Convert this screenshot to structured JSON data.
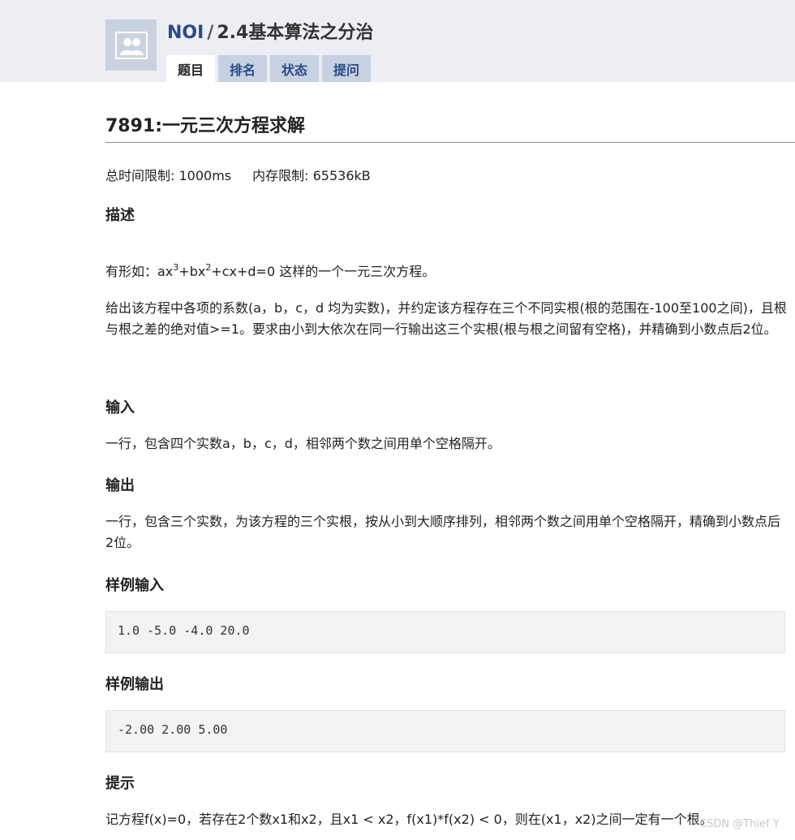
{
  "header": {
    "logo_icon": "people-avatar-icon",
    "site_name": "NOI",
    "separator": "/",
    "section": "2.4基本算法之分治",
    "tabs": [
      {
        "label": "题目",
        "active": true
      },
      {
        "label": "排名",
        "active": false
      },
      {
        "label": "状态",
        "active": false
      },
      {
        "label": "提问",
        "active": false
      }
    ]
  },
  "problem": {
    "title": "7891:一元三次方程求解",
    "time_limit": "总时间限制: 1000ms",
    "memory_limit": "内存限制: 65536kB",
    "sections": {
      "description": {
        "heading": "描述",
        "line1_prefix": "有形如：ax",
        "line1_sup1": "3",
        "line1_mid": "+bx",
        "line1_sup2": "2",
        "line1_suffix": "+cx+d=0  这样的一个一元三次方程。",
        "paragraph2": "给出该方程中各项的系数(a，b，c，d  均为实数)，并约定该方程存在三个不同实根(根的范围在-100至100之间)，且根与根之差的绝对值>=1。要求由小到大依次在同一行输出这三个实根(根与根之间留有空格)，并精确到小数点后2位。"
      },
      "input": {
        "heading": "输入",
        "text": "一行，包含四个实数a，b，c，d，相邻两个数之间用单个空格隔开。"
      },
      "output": {
        "heading": "输出",
        "text": "一行，包含三个实数，为该方程的三个实根，按从小到大顺序排列，相邻两个数之间用单个空格隔开，精确到小数点后2位。"
      },
      "sample_input": {
        "heading": "样例输入",
        "code": "1.0 -5.0 -4.0 20.0"
      },
      "sample_output": {
        "heading": "样例输出",
        "code": "-2.00 2.00 5.00"
      },
      "hint": {
        "heading": "提示",
        "text": "记方程f(x)=0，若存在2个数x1和x2，且x1 < x2，f(x1)*f(x2) < 0，则在(x1，x2)之间一定有一个根。"
      }
    }
  },
  "watermark": "CSDN @Thief Y"
}
